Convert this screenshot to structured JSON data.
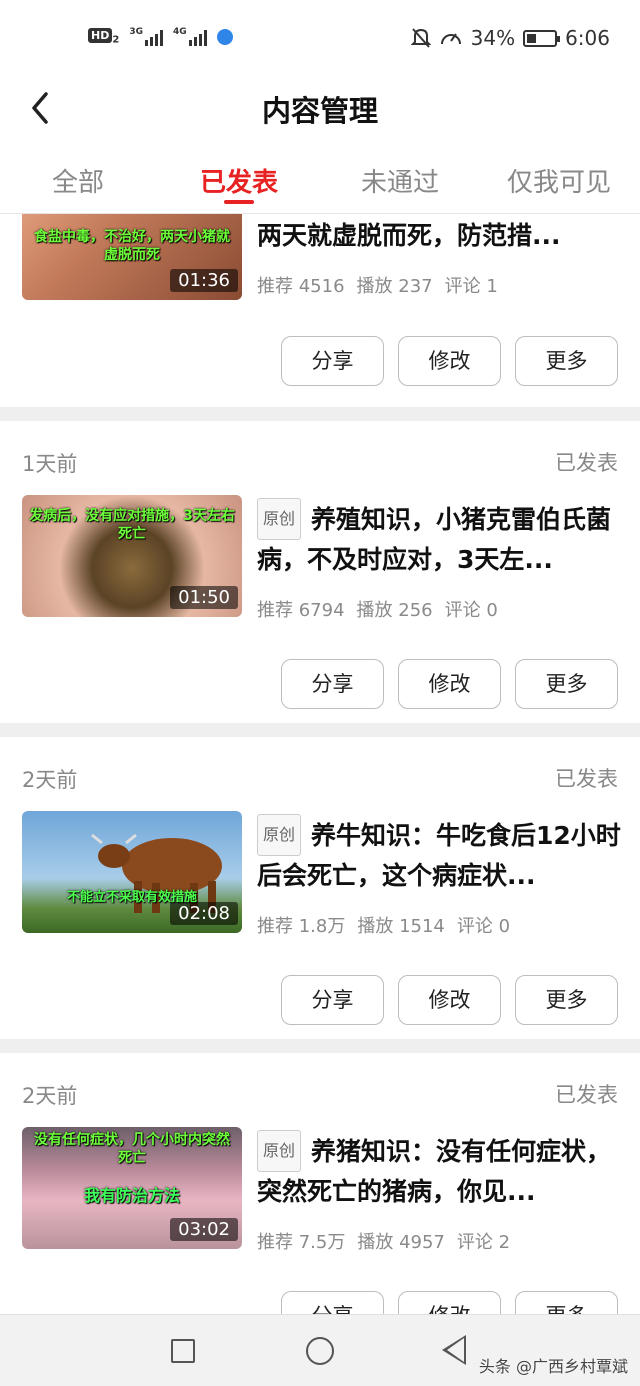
{
  "status_bar": {
    "left": {
      "hd": "HD",
      "hd_sub": "2",
      "net1": "3G",
      "net2": "4G"
    },
    "battery_percent": "34%",
    "battery_level": 0.34,
    "time": "6:06"
  },
  "header": {
    "back_icon": "chevron-left-icon",
    "title": "内容管理"
  },
  "tabs": [
    {
      "label": "全部",
      "active": false
    },
    {
      "label": "已发表",
      "active": true
    },
    {
      "label": "未通过",
      "active": false
    },
    {
      "label": "仅我可见",
      "active": false
    }
  ],
  "colors": {
    "accent": "#e82222",
    "separator": "#efefef",
    "caption_green": "#6cff3a"
  },
  "articles": [
    {
      "date": "",
      "status": "",
      "title": "两天就虚脱而死，防范措...",
      "original": "",
      "thumb_caption": "食盐中毒，不治好，两天小猪就虚脱而死",
      "duration": "01:36",
      "stats": {
        "recommend": "推荐 4516",
        "play": "播放 237",
        "comment": "评论 1"
      },
      "buttons": {
        "share": "分享",
        "edit": "修改",
        "more": "更多"
      }
    },
    {
      "date": "1天前",
      "status": "已发表",
      "original": "原创",
      "title": "养殖知识，小猪克雷伯氏菌病，不及时应对，3天左...",
      "thumb_caption": "发病后，没有应对措施，3天左右死亡",
      "duration": "01:50",
      "stats": {
        "recommend": "推荐 6794",
        "play": "播放 256",
        "comment": "评论 0"
      },
      "buttons": {
        "share": "分享",
        "edit": "修改",
        "more": "更多"
      }
    },
    {
      "date": "2天前",
      "status": "已发表",
      "original": "原创",
      "title": "养牛知识：牛吃食后12小时后会死亡，这个病症状...",
      "thumb_caption": "不能立不采取有效措施",
      "duration": "02:08",
      "stats": {
        "recommend": "推荐 1.8万",
        "play": "播放 1514",
        "comment": "评论 0"
      },
      "buttons": {
        "share": "分享",
        "edit": "修改",
        "more": "更多"
      }
    },
    {
      "date": "2天前",
      "status": "已发表",
      "original": "原创",
      "title": "养猪知识：没有任何症状，突然死亡的猪病，你见...",
      "thumb_caption": "没有任何症状，几个小时内突然死亡",
      "thumb_caption2": "我有防治方法",
      "duration": "03:02",
      "stats": {
        "recommend": "推荐 7.5万",
        "play": "播放 4957",
        "comment": "评论 2"
      },
      "buttons": {
        "share": "分享",
        "edit": "修改",
        "more": "更多"
      }
    }
  ],
  "navbar": {
    "recent_icon": "square-icon",
    "home_icon": "circle-icon",
    "back_icon": "triangle-back-icon"
  },
  "watermark": "头条 @广西乡村覃斌"
}
